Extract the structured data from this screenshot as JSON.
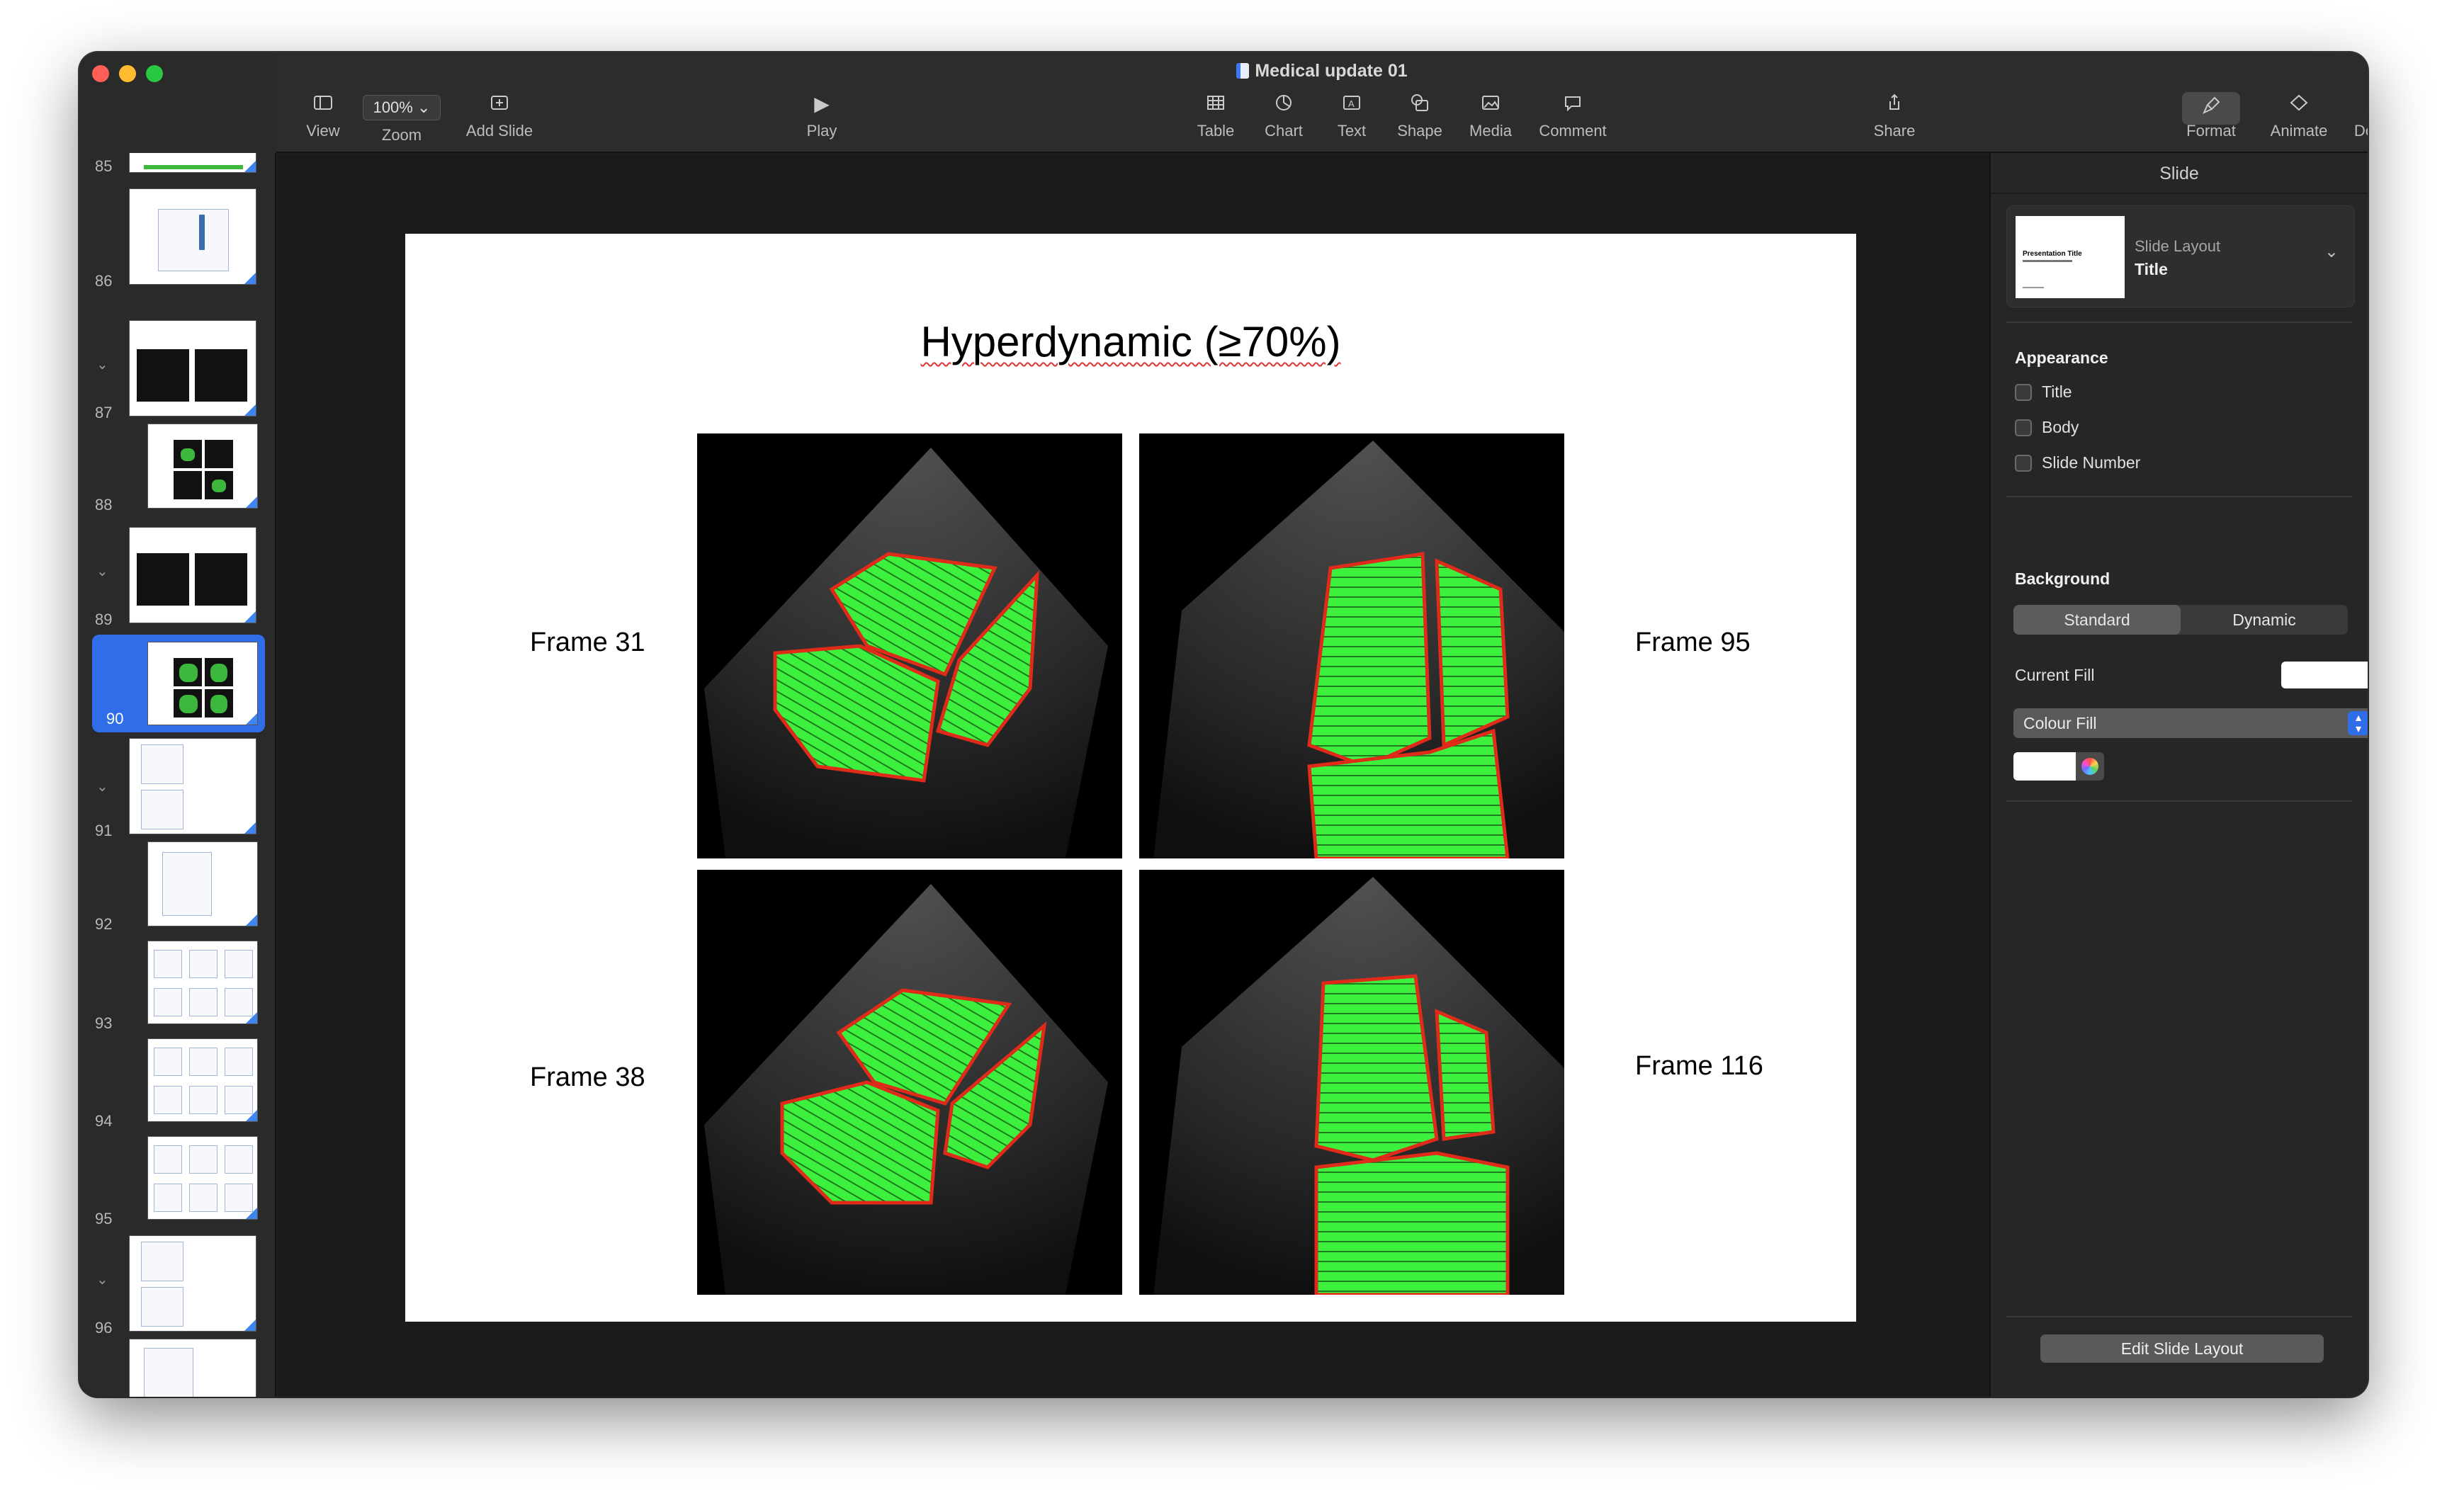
{
  "window": {
    "title": "Medical update 01"
  },
  "toolbar": {
    "view": "View",
    "zoom_value": "100%",
    "zoom": "Zoom",
    "add_slide": "Add Slide",
    "play": "Play",
    "table": "Table",
    "chart": "Chart",
    "text": "Text",
    "shape": "Shape",
    "media": "Media",
    "comment": "Comment",
    "share": "Share",
    "format": "Format",
    "animate": "Animate",
    "document": "Document"
  },
  "navigator": {
    "slides": [
      {
        "number": "85"
      },
      {
        "number": "86"
      },
      {
        "number": "87"
      },
      {
        "number": "88"
      },
      {
        "number": "89"
      },
      {
        "number": "90",
        "selected": true
      },
      {
        "number": "91"
      },
      {
        "number": "92"
      },
      {
        "number": "93"
      },
      {
        "number": "94"
      },
      {
        "number": "95"
      },
      {
        "number": "96"
      }
    ]
  },
  "slide": {
    "title": "Hyperdynamic (≥70%)",
    "frames": {
      "top_left": "Frame 31",
      "top_right": "Frame 95",
      "bottom_left": "Frame 38",
      "bottom_right": "Frame 116"
    }
  },
  "inspector": {
    "header": "Slide",
    "layout_label": "Slide Layout",
    "layout_value": "Title",
    "layout_thumb_title": "Presentation Title",
    "appearance": {
      "title": "Appearance",
      "options": [
        "Title",
        "Body",
        "Slide Number"
      ]
    },
    "background": {
      "title": "Background",
      "standard": "Standard",
      "dynamic": "Dynamic",
      "current_fill": "Current Fill",
      "fill_type": "Colour Fill"
    },
    "edit_layout_button": "Edit Slide Layout"
  },
  "colors": {
    "accent": "#2f6ee8",
    "segmentation_fill": "#3df03d",
    "segmentation_outline": "#e02a1a"
  }
}
